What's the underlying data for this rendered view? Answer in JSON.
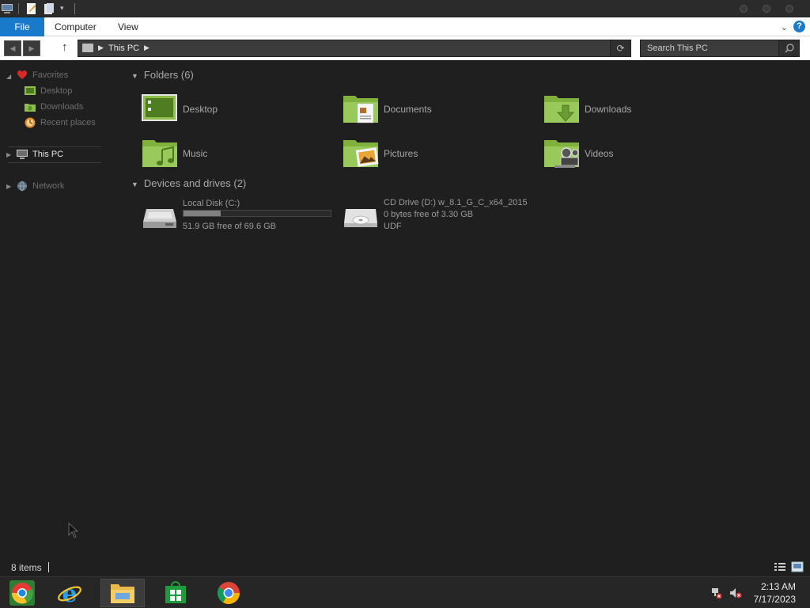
{
  "ribbon": {
    "file_label": "File",
    "tabs": [
      "Computer",
      "View"
    ],
    "help_label": "?"
  },
  "address": {
    "location": "This PC",
    "search_placeholder": "Search This PC"
  },
  "nav": {
    "favorites_label": "Favorites",
    "favorites": [
      "Desktop",
      "Downloads",
      "Recent places"
    ],
    "this_pc_label": "This PC",
    "network_label": "Network"
  },
  "content": {
    "folders_header": "Folders (6)",
    "folders": [
      "Desktop",
      "Documents",
      "Downloads",
      "Music",
      "Pictures",
      "Videos"
    ],
    "drives_header": "Devices and drives (2)",
    "drives": [
      {
        "name": "Local Disk (C:)",
        "free_text": "51.9 GB free of 69.6 GB",
        "used_fraction": 0.25
      },
      {
        "name": "CD Drive (D:) w_8.1_G_C_x64_2015",
        "free_text": "0 bytes free of 3.30 GB",
        "fs": "UDF"
      }
    ]
  },
  "status": {
    "item_count": "8 items"
  },
  "taskbar": {
    "apps": [
      "chrome-remote-icon",
      "internet-explorer-icon",
      "file-explorer-icon",
      "store-icon",
      "chrome-icon"
    ],
    "time": "2:13 AM",
    "date": "7/17/2023"
  },
  "colors": {
    "accent": "#1979ca",
    "folder_green": "#8fbf4a",
    "background": "#1f1f1f"
  }
}
